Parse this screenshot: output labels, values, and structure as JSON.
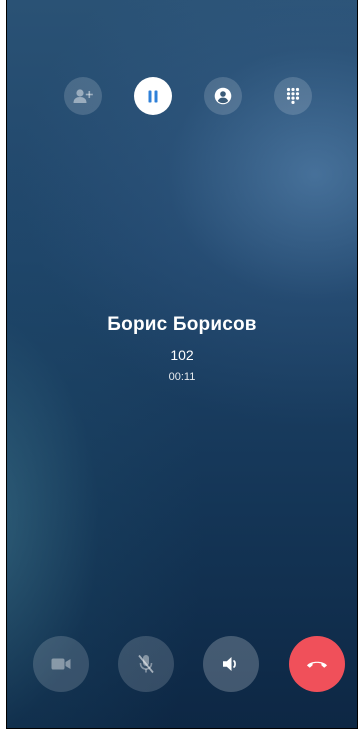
{
  "call": {
    "name": "Борис Борисов",
    "number": "102",
    "timer": "00:11"
  },
  "top_actions": [
    {
      "name": "add-participant-icon",
      "state": "disabled"
    },
    {
      "name": "pause-icon",
      "state": "active"
    },
    {
      "name": "contact-icon",
      "state": "normal"
    },
    {
      "name": "dialpad-icon",
      "state": "normal"
    }
  ],
  "bottom_actions": [
    {
      "name": "video-camera-icon",
      "state": "disabled"
    },
    {
      "name": "microphone-muted-icon",
      "state": "disabled"
    },
    {
      "name": "speaker-icon",
      "state": "normal"
    },
    {
      "name": "end-call-icon",
      "state": "destructive"
    }
  ],
  "colors": {
    "background_top": "#2a5275",
    "background_bottom": "#0d2744",
    "active_button": "#ffffff",
    "pause_icon": "#2f80d8",
    "end_call": "#f0505a"
  }
}
